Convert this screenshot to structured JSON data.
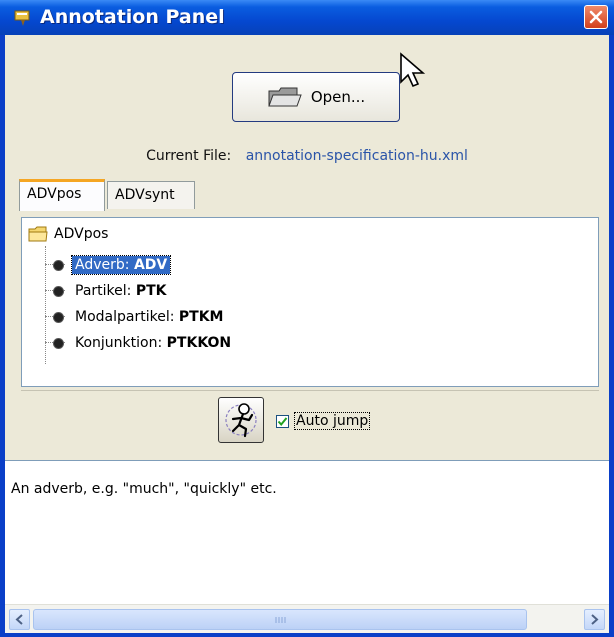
{
  "window": {
    "title": "Annotation Panel",
    "icons": {
      "app": "annotation-app-icon",
      "close": "close-icon"
    }
  },
  "toolbar": {
    "open_label": "Open...",
    "open_icon": "folder-icon"
  },
  "current_file": {
    "label": "Current File:",
    "value": "annotation-specification-hu.xml"
  },
  "tabs": [
    {
      "label": "ADVpos",
      "active": true
    },
    {
      "label": "ADVsynt",
      "active": false
    }
  ],
  "tree": {
    "root": {
      "label": "ADVpos",
      "icon": "folder-icon"
    },
    "items": [
      {
        "name": "Adverb:",
        "code": "ADV",
        "selected": true
      },
      {
        "name": "Partikel:",
        "code": "PTK",
        "selected": false
      },
      {
        "name": "Modalpartikel:",
        "code": "PTKM",
        "selected": false
      },
      {
        "name": "Konjunktion:",
        "code": "PTKKON",
        "selected": false
      }
    ]
  },
  "controls": {
    "jump_icon": "running-person-icon",
    "auto_jump_label": "Auto jump",
    "auto_jump_checked": true
  },
  "description": {
    "text": "An adverb, e.g. \"much\", \"quickly\" etc."
  },
  "colors": {
    "titlebar": "#0548d0",
    "selection": "#316ac5",
    "file_link": "#2a54a8",
    "close_button": "#d2401c"
  }
}
